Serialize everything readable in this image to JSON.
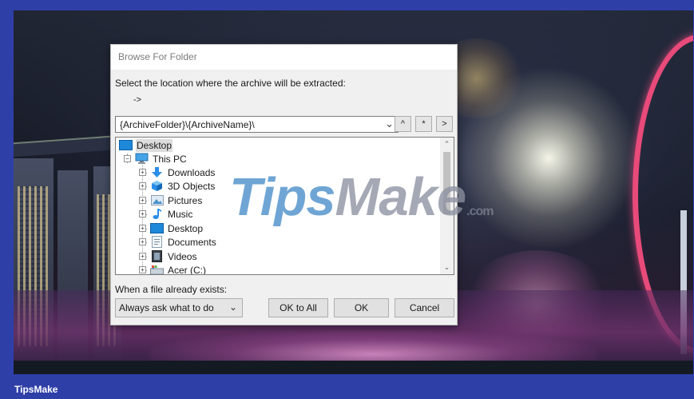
{
  "dialog": {
    "title": "Browse For Folder",
    "prompt": "Select the location where the archive will be extracted:",
    "arrow_text": "->",
    "path_value": "{ArchiveFolder}\\{ArchiveName}\\",
    "up_button": "^",
    "star_button": "*",
    "go_button": ">",
    "tree": [
      {
        "label": "Desktop",
        "icon": "desktop-icon",
        "selected": true
      },
      {
        "label": "This PC",
        "icon": "computer-icon"
      },
      {
        "label": "Downloads",
        "icon": "downloads-icon"
      },
      {
        "label": "3D Objects",
        "icon": "3d-objects-icon"
      },
      {
        "label": "Pictures",
        "icon": "pictures-icon"
      },
      {
        "label": "Music",
        "icon": "music-icon"
      },
      {
        "label": "Desktop",
        "icon": "desktop-icon"
      },
      {
        "label": "Documents",
        "icon": "documents-icon"
      },
      {
        "label": "Videos",
        "icon": "videos-icon"
      },
      {
        "label": "Acer (C:)",
        "icon": "drive-icon"
      }
    ],
    "exists_label": "When a file already exists:",
    "exists_option": "Always ask what to do",
    "ok_all_button": "OK to All",
    "ok_button": "OK",
    "cancel_button": "Cancel"
  },
  "watermark": {
    "part1": "Tips",
    "part2": "Make",
    "suffix": ".com"
  },
  "brand": "TipsMake",
  "colors": {
    "frame": "#2f3fa8",
    "dialog_bg": "#f0f0f0",
    "selection": "#dcdcdc"
  }
}
